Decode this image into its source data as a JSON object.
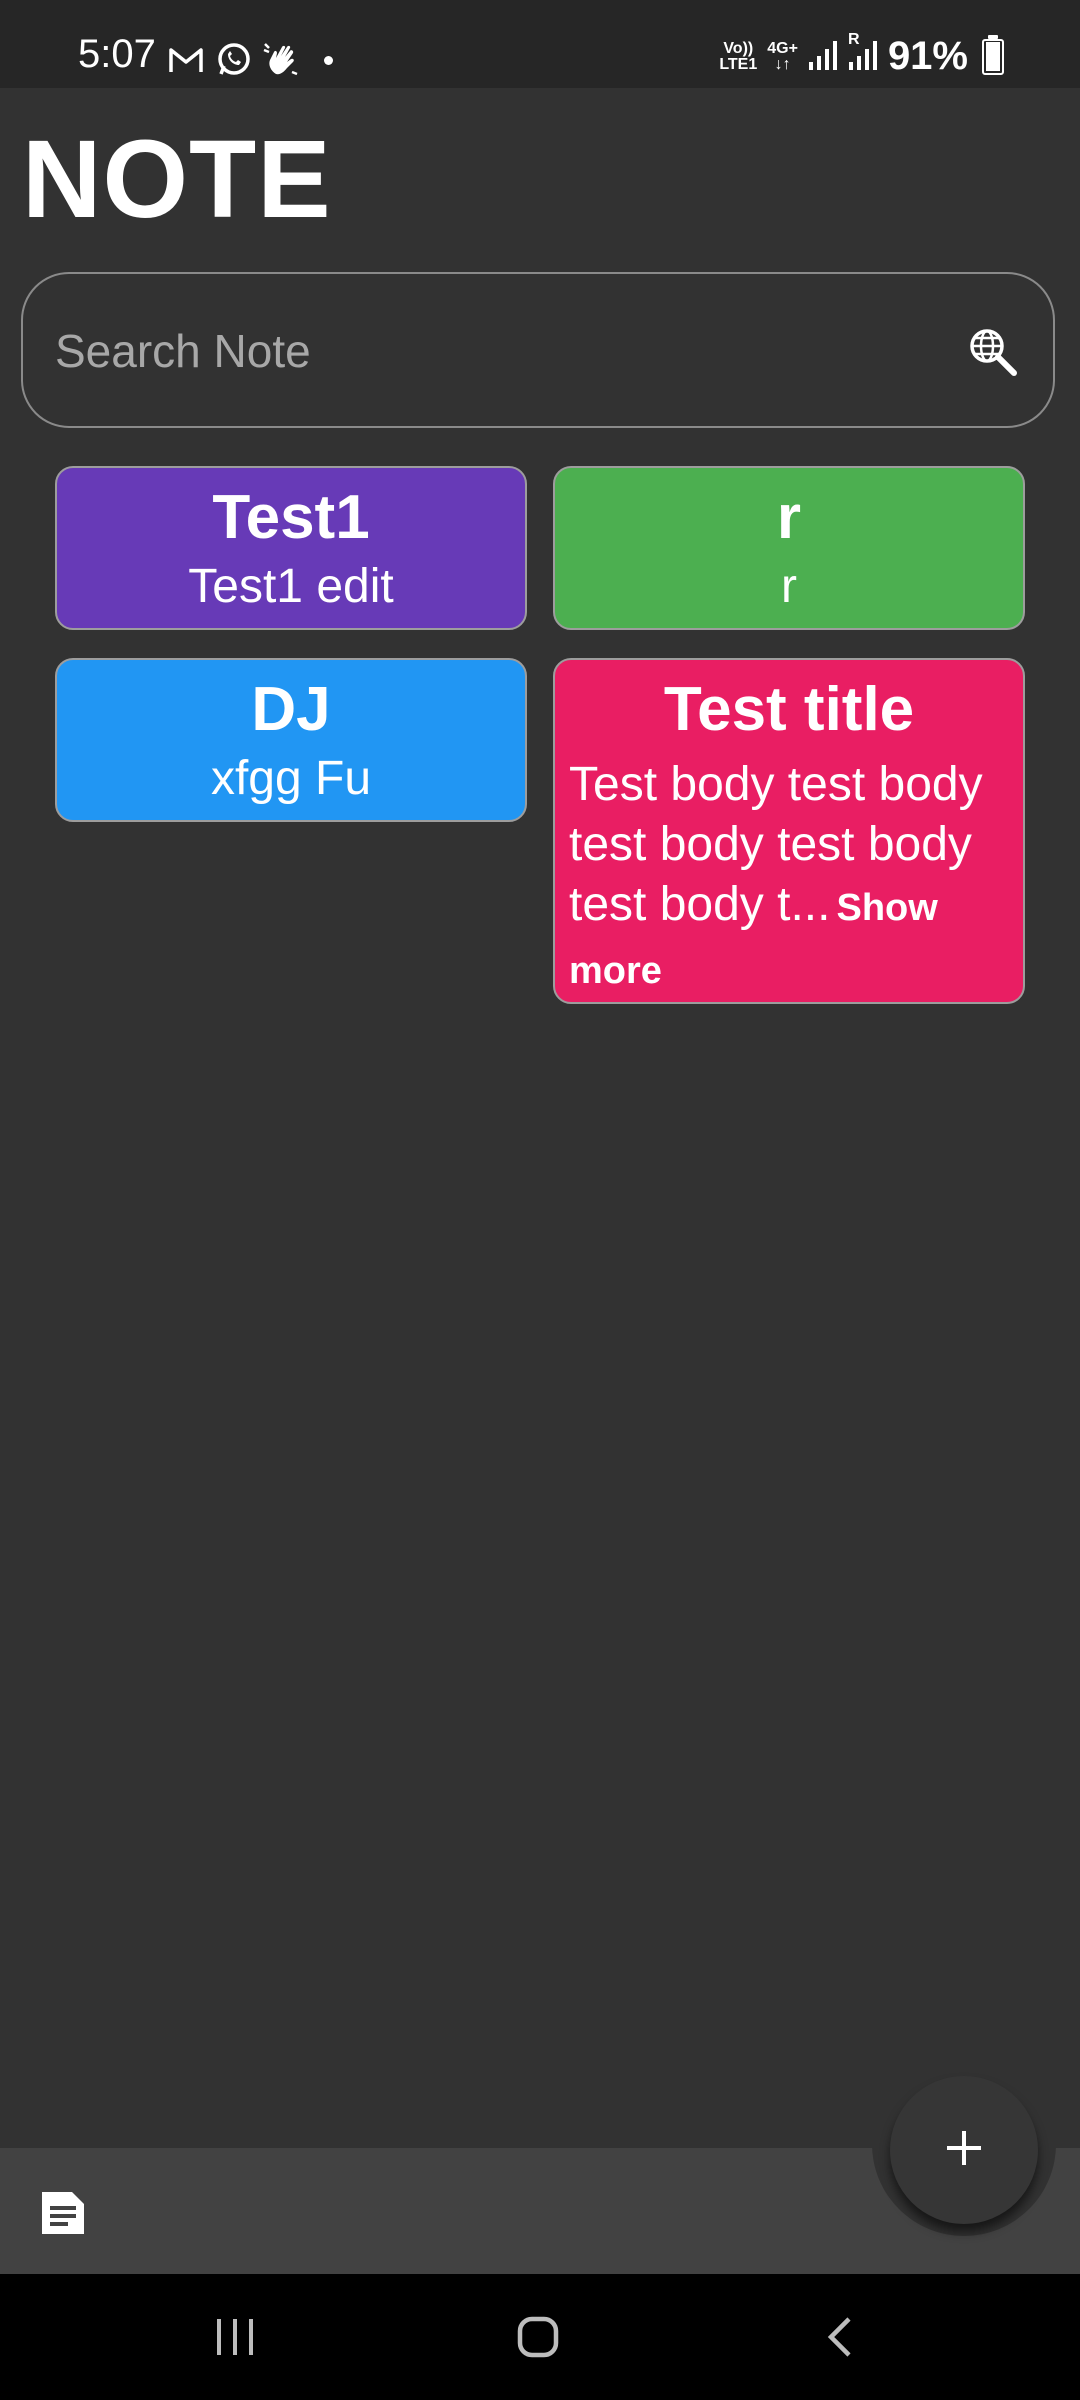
{
  "status_bar": {
    "time": "5:07",
    "network": {
      "volte": "Vo))",
      "lte": "LTE1",
      "data": "4G+",
      "roaming": "R"
    },
    "battery_percent": "91%",
    "battery_level": 0.91
  },
  "header": {
    "title": "NOTE"
  },
  "search": {
    "placeholder": "Search Note",
    "value": ""
  },
  "notes": [
    {
      "title": "Test1",
      "body": "Test1 edit",
      "color": "#673ab7"
    },
    {
      "title": "r",
      "body": "r",
      "color": "#4caf50"
    },
    {
      "title": "DJ",
      "body": "xfgg Fu",
      "color": "#2196f3"
    },
    {
      "title": "Test title",
      "body": "Test body test body test body test body test body t...",
      "show_more": "Show more",
      "color": "#e91e63"
    }
  ],
  "bottom_bar": {
    "icons": [
      "note-icon"
    ],
    "fab": "plus-icon"
  },
  "nav_bar": {
    "icons": [
      "recent-apps-icon",
      "home-icon",
      "back-icon"
    ]
  }
}
